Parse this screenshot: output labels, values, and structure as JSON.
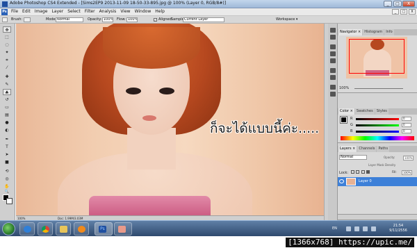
{
  "window": {
    "title": "Adobe Photoshop CS4 Extended - [Sims2EP9 2013-11-09 18-50-33-895.jpg @ 100% (Layer 0, RGB/8#)]",
    "minimize": "_",
    "maximize": "□",
    "close": "X"
  },
  "menubar": {
    "logo": "Ps",
    "items": [
      "File",
      "Edit",
      "Image",
      "Layer",
      "Select",
      "Filter",
      "Analysis",
      "View",
      "Window",
      "Help"
    ],
    "right_buttons": [
      "_",
      "□",
      "X"
    ]
  },
  "options": {
    "brush_label": "Brush:",
    "mode_label": "Mode:",
    "mode_value": "Normal",
    "opacity_label": "Opacity:",
    "opacity_value": "100%",
    "flow_label": "Flow:",
    "flow_value": "100%",
    "aligned_label": "Aligned",
    "aligned_checked": "✓",
    "sample_label": "Sample:",
    "sample_value": "Current Layer",
    "workspace_label": "Workspace ▾"
  },
  "toolbar": {
    "tool_icons": [
      "move-icon",
      "marquee-icon",
      "lasso-icon",
      "magic-wand-icon",
      "crop-icon",
      "eyedropper-icon",
      "healing-brush-icon",
      "brush-icon",
      "clone-stamp-icon",
      "history-brush-icon",
      "eraser-icon",
      "gradient-icon",
      "blur-icon",
      "dodge-icon",
      "pen-icon",
      "type-icon",
      "path-select-icon",
      "shape-icon",
      "3d-rotate-icon",
      "3d-orbit-icon",
      "hand-icon",
      "zoom-icon"
    ],
    "type_glyph": "T",
    "foreground_color": "#000000",
    "background_color": "#ffffff"
  },
  "canvas": {
    "caption": "ก็จะได้แบบนี้ค่ะ.....",
    "zoom": "100%",
    "doc_info": "Doc: 1.99M/3.03M"
  },
  "panels": {
    "navigator": {
      "tabs": [
        "Navigator ×",
        "Histogram",
        "Info"
      ],
      "zoom_value": "100%"
    },
    "color": {
      "tabs": [
        "Color ×",
        "Swatches",
        "Styles"
      ],
      "channels": [
        {
          "label": "R",
          "value": "0",
          "color": "#ff0000"
        },
        {
          "label": "G",
          "value": "0",
          "color": "#00ff00"
        },
        {
          "label": "B",
          "value": "0",
          "color": "#0000ff"
        }
      ]
    },
    "layers": {
      "tabs": [
        "Layers ×",
        "Channels",
        "Paths"
      ],
      "blend_mode": "Normal",
      "opacity_label": "Opacity:",
      "opacity_value": "100%",
      "layer_mask_label": "Layer Mask Density",
      "lock_label": "Lock:",
      "fill_label": "Fill:",
      "fill_value": "100%",
      "layer_name": "Layer 0"
    }
  },
  "taskbar": {
    "apps": [
      "ie-icon",
      "chrome-icon",
      "explorer-icon",
      "media-player-icon",
      "photoshop-icon",
      "active-window-icon"
    ],
    "photoshop_label": "Ps",
    "language": "EN",
    "time": "21:54",
    "date": "9/11/2556"
  },
  "footer": {
    "watermark": "[1366x768] https://upic.me/"
  },
  "colors": {
    "accent": "#3d80d8",
    "nav_view_box": "#ff0000"
  }
}
